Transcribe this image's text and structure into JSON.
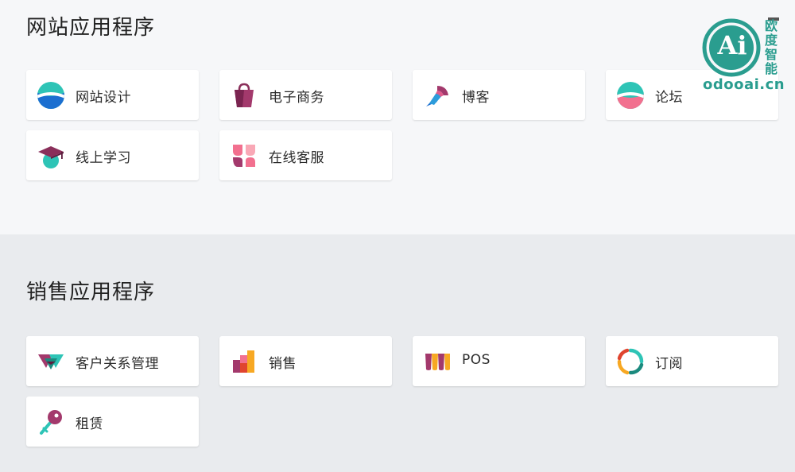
{
  "web_section": {
    "title": "网站应用程序",
    "apps": [
      {
        "label": "网站设计",
        "icon": "website-icon"
      },
      {
        "label": "电子商务",
        "icon": "ecommerce-bag-icon"
      },
      {
        "label": "博客",
        "icon": "blog-icon"
      },
      {
        "label": "论坛",
        "icon": "forum-icon"
      },
      {
        "label": "线上学习",
        "icon": "elearning-cap-icon"
      },
      {
        "label": "在线客服",
        "icon": "livechat-icon"
      }
    ]
  },
  "sales_section": {
    "title": "销售应用程序",
    "apps": [
      {
        "label": "客户关系管理",
        "icon": "crm-handshake-icon"
      },
      {
        "label": "销售",
        "icon": "sales-bars-icon"
      },
      {
        "label": "POS",
        "icon": "pos-awning-icon"
      },
      {
        "label": "订阅",
        "icon": "subscription-cycle-icon"
      },
      {
        "label": "租赁",
        "icon": "rental-key-icon"
      }
    ]
  },
  "watermark": {
    "badge": "Ai",
    "cn": [
      "欧",
      "度",
      "智",
      "能"
    ],
    "domain": "odooai.cn",
    "color": "#2a9d8f"
  }
}
